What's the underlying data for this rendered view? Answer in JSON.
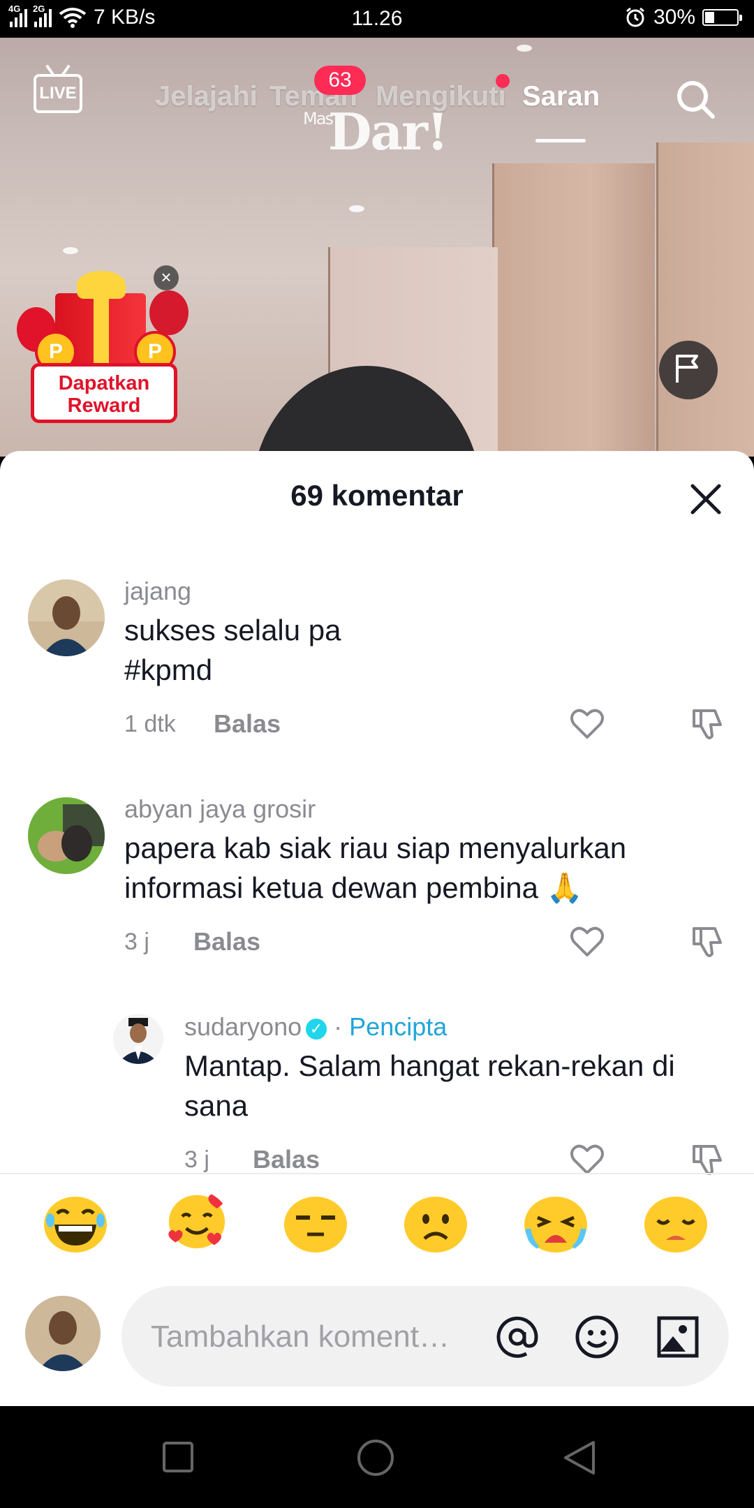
{
  "status_bar": {
    "network_left": "4G",
    "network_right": "2G",
    "speed": "7 KB/s",
    "time": "11.26",
    "battery": "30%",
    "battery_level": 0.3
  },
  "top_nav": {
    "live_label": "LIVE",
    "tabs": [
      {
        "label": "Jelajahi"
      },
      {
        "label": "Teman"
      },
      {
        "label": "Mengikuti"
      },
      {
        "label": "Saran"
      }
    ],
    "active_tab": "Saran",
    "friends_badge": "63",
    "watermark": "Dar!",
    "watermark_prefix": "Mas"
  },
  "reward_widget": {
    "line1": "Dapatkan",
    "line2": "Reward",
    "close_symbol": "×"
  },
  "comments_panel": {
    "title": "69 komentar",
    "comments": [
      {
        "username": "jajang",
        "text_line1": "sukses selalu pa",
        "text_line2": "#kpmd",
        "time": "1 dtk",
        "reply_label": "Balas"
      },
      {
        "username": "abyan jaya grosir",
        "text_line1": "papera kab siak riau siap menyalurkan",
        "text_line2": "informasi ketua dewan pembina 🙏",
        "time": "3 j",
        "reply_label": "Balas"
      },
      {
        "username": "sudaryono",
        "creator_sep": "·",
        "creator_label": "Pencipta",
        "text_line1": "Mantap. Salam hangat rekan-rekan di",
        "text_line2": "sana",
        "time": "3 j",
        "reply_label": "Balas"
      }
    ],
    "quick_emojis": [
      "laughing-emoji",
      "hearts-emoji",
      "unamused-emoji",
      "frowning-emoji",
      "crying-emoji",
      "sad-emoji"
    ],
    "input_placeholder": "Tambahkan koment…"
  },
  "colors": {
    "accent": "#fe2c55",
    "creator": "#20a5d8",
    "text_primary": "#161823",
    "text_secondary": "#8a8b91"
  }
}
